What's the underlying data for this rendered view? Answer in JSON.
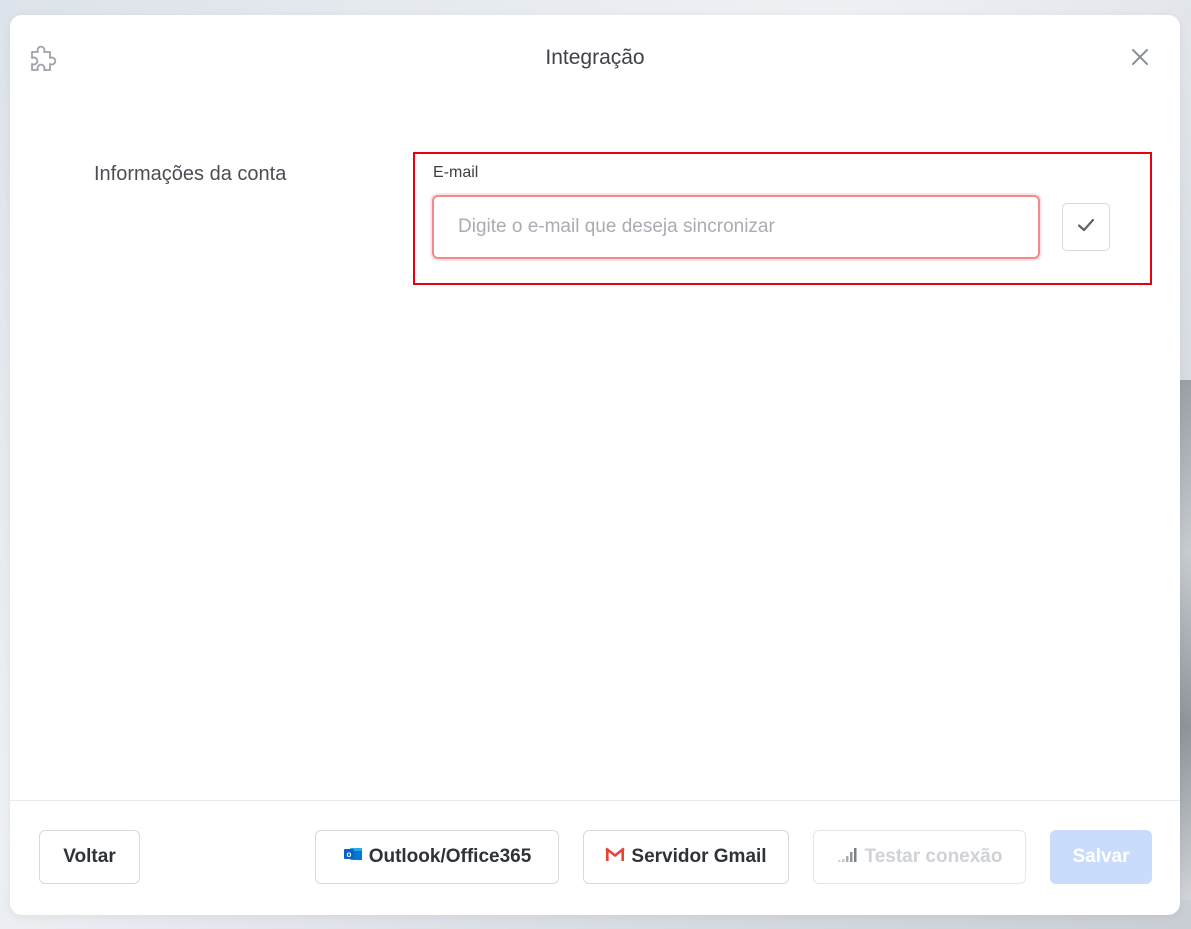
{
  "dialog": {
    "title": "Integração",
    "header_icon": "puzzle-icon",
    "close_icon": "close-icon"
  },
  "account_section": {
    "label": "Informações da conta",
    "email_field": {
      "label": "E-mail",
      "value": "",
      "placeholder": "Digite o e-mail que deseja sincronizar"
    },
    "confirm_icon": "check-icon"
  },
  "footer": {
    "back_label": "Voltar",
    "outlook_label": "Outlook/Office365",
    "outlook_icon": "outlook-icon",
    "gmail_label": "Servidor Gmail",
    "gmail_icon": "gmail-icon",
    "test_label": "Testar conexão",
    "test_icon": "signal-bars-icon",
    "save_label": "Salvar"
  },
  "colors": {
    "highlight": "#e60012",
    "input_error_border": "#f08a8f",
    "save_disabled_bg": "#c9dcfb",
    "outlook_blue": "#0a64c8",
    "gmail_red": "#ea4335"
  }
}
